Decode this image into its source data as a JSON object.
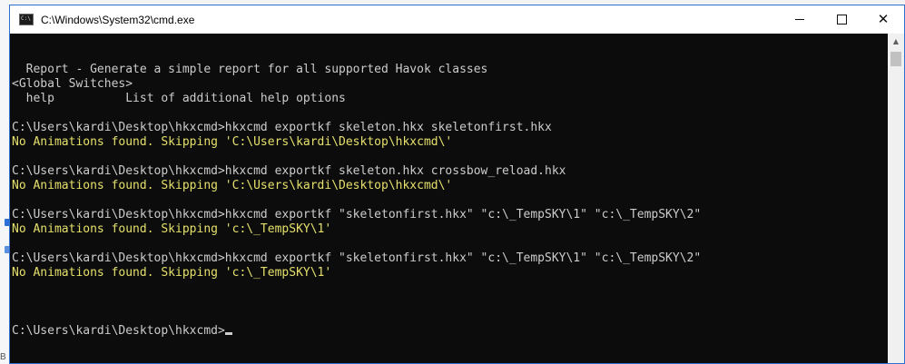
{
  "window": {
    "title": "C:\\Windows\\System32\\cmd.exe",
    "controls": {
      "minimize": "minimize",
      "maximize": "maximize",
      "close": "close"
    }
  },
  "console": {
    "lines": [
      {
        "text": "  Report - Generate a simple report for all supported Havok classes",
        "kind": "output"
      },
      {
        "text": "<Global Switches>",
        "kind": "output"
      },
      {
        "text": "  help          List of additional help options",
        "kind": "output"
      },
      {
        "text": "",
        "kind": "output"
      },
      {
        "text": "C:\\Users\\kardi\\Desktop\\hkxcmd>hkxcmd exportkf skeleton.hkx skeletonfirst.hkx",
        "kind": "output"
      },
      {
        "text": "No Animations found. Skipping 'C:\\Users\\kardi\\Desktop\\hkxcmd\\'",
        "kind": "warn"
      },
      {
        "text": "",
        "kind": "output"
      },
      {
        "text": "C:\\Users\\kardi\\Desktop\\hkxcmd>hkxcmd exportkf skeleton.hkx crossbow_reload.hkx",
        "kind": "output"
      },
      {
        "text": "No Animations found. Skipping 'C:\\Users\\kardi\\Desktop\\hkxcmd\\'",
        "kind": "warn"
      },
      {
        "text": "",
        "kind": "output"
      },
      {
        "text": "C:\\Users\\kardi\\Desktop\\hkxcmd>hkxcmd exportkf \"skeletonfirst.hkx\" \"c:\\_TempSKY\\1\" \"c:\\_TempSKY\\2\"",
        "kind": "output"
      },
      {
        "text": "No Animations found. Skipping 'c:\\_TempSKY\\1'",
        "kind": "warn"
      },
      {
        "text": "",
        "kind": "output"
      },
      {
        "text": "C:\\Users\\kardi\\Desktop\\hkxcmd>hkxcmd exportkf \"skeletonfirst.hkx\" \"c:\\_TempSKY\\1\" \"c:\\_TempSKY\\2\"",
        "kind": "output"
      },
      {
        "text": "No Animations found. Skipping 'c:\\_TempSKY\\1'",
        "kind": "warn"
      },
      {
        "text": "",
        "kind": "output"
      }
    ],
    "prompt": "C:\\Users\\kardi\\Desktop\\hkxcmd>"
  },
  "colors": {
    "console_bg": "#0c0c0c",
    "console_text": "#cccccc",
    "warn_text": "#e5e06b",
    "window_border": "#2e6fd0"
  },
  "icons": {
    "app": "cmd-console-icon",
    "minimize": "minimize-icon",
    "maximize": "maximize-icon",
    "close": "close-icon",
    "scroll_up": "scroll-up-arrow-icon"
  },
  "background": {
    "bottom_left_text": "B i"
  }
}
